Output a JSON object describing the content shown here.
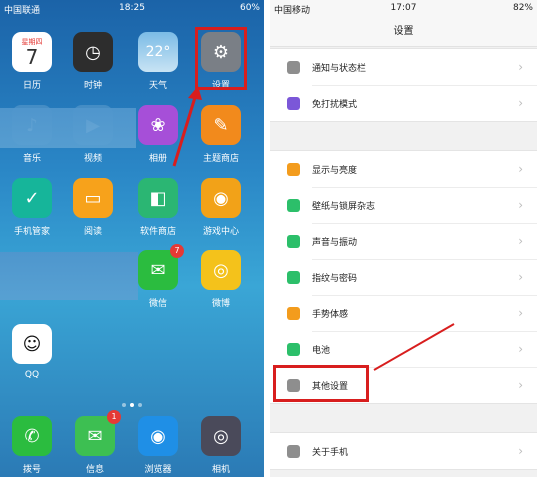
{
  "left": {
    "status": {
      "carrier": "中国联通",
      "time": "18:25",
      "battery": "60%"
    },
    "apps": [
      {
        "id": "calendar",
        "label": "日历",
        "badge": null,
        "icon": "calendar-icon",
        "weekday": "星期四",
        "day": "7"
      },
      {
        "id": "clock",
        "label": "时钟",
        "badge": null,
        "icon": "clock-icon"
      },
      {
        "id": "weather",
        "label": "天气",
        "badge": null,
        "icon": "weather-icon",
        "temp": "22°"
      },
      {
        "id": "settings",
        "label": "设置",
        "badge": null,
        "icon": "gear-icon"
      },
      {
        "id": "music",
        "label": "音乐",
        "badge": null,
        "icon": "music-icon"
      },
      {
        "id": "video",
        "label": "视频",
        "badge": null,
        "icon": "video-icon"
      },
      {
        "id": "gallery",
        "label": "相册",
        "badge": null,
        "icon": "flower-icon"
      },
      {
        "id": "theme",
        "label": "主题商店",
        "badge": null,
        "icon": "palette-icon"
      },
      {
        "id": "phone_manager",
        "label": "手机管家",
        "badge": null,
        "icon": "shield-icon"
      },
      {
        "id": "reader",
        "label": "阅读",
        "badge": null,
        "icon": "book-icon"
      },
      {
        "id": "store",
        "label": "软件商店",
        "badge": null,
        "icon": "store-icon"
      },
      {
        "id": "game",
        "label": "游戏中心",
        "badge": null,
        "icon": "game-icon"
      },
      {
        "id": "wechat",
        "label": "微信",
        "badge": "7",
        "icon": "wechat-icon"
      },
      {
        "id": "weibo",
        "label": "微博",
        "badge": null,
        "icon": "weibo-icon"
      },
      {
        "id": "qq",
        "label": "QQ",
        "badge": null,
        "icon": "qq-icon"
      }
    ],
    "dock": [
      {
        "id": "dialer",
        "label": "拨号",
        "badge": null,
        "icon": "phone-icon"
      },
      {
        "id": "messages",
        "label": "信息",
        "badge": "1",
        "icon": "message-icon"
      },
      {
        "id": "browser",
        "label": "浏览器",
        "badge": null,
        "icon": "browser-icon"
      },
      {
        "id": "camera",
        "label": "相机",
        "badge": null,
        "icon": "camera-icon"
      }
    ]
  },
  "right": {
    "status": {
      "carrier": "中国移动",
      "time": "17:07",
      "battery": "82%"
    },
    "title": "设置",
    "groups": [
      [
        {
          "label": "通知与状态栏",
          "icon": "notification-icon",
          "color": "#8e8e8e"
        },
        {
          "label": "免打扰模式",
          "icon": "moon-icon",
          "color": "#7b57d8"
        }
      ],
      [
        {
          "label": "显示与亮度",
          "icon": "display-icon",
          "color": "#f39c1d"
        },
        {
          "label": "壁纸与锁屏杂志",
          "icon": "wallpaper-icon",
          "color": "#2cbf6a"
        },
        {
          "label": "声音与振动",
          "icon": "sound-icon",
          "color": "#2cbf6a"
        },
        {
          "label": "指纹与密码",
          "icon": "fingerprint-icon",
          "color": "#2cbf6a"
        },
        {
          "label": "手势体感",
          "icon": "gesture-icon",
          "color": "#f39c1d"
        },
        {
          "label": "电池",
          "icon": "battery-icon",
          "color": "#2cbf6a"
        },
        {
          "label": "其他设置",
          "icon": "more-icon",
          "color": "#8e8e8e"
        }
      ],
      [
        {
          "label": "关于手机",
          "icon": "info-icon",
          "color": "#8e8e8e"
        }
      ]
    ]
  }
}
